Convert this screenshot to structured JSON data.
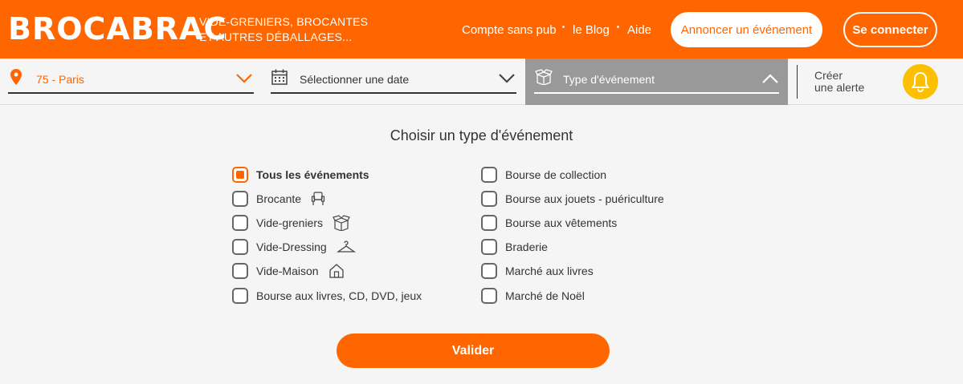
{
  "header": {
    "logo": "BROCABRAC",
    "tagline_line1": "VIDE-GRENIERS, BROCANTES",
    "tagline_line2": "ET AUTRES DÉBALLAGES...",
    "nav": {
      "no_ads": "Compte sans pub",
      "blog": "le Blog",
      "help": "Aide"
    },
    "announce_button": "Annoncer un événement",
    "login_button": "Se connecter"
  },
  "filters": {
    "location": "75 - Paris",
    "date": "Sélectionner une date",
    "type": "Type d'événement",
    "alert_line1": "Créer",
    "alert_line2": "une alerte"
  },
  "panel": {
    "title": "Choisir un type d'événement",
    "left_options": [
      {
        "label": "Tous les événements",
        "checked": true,
        "icon": ""
      },
      {
        "label": "Brocante",
        "checked": false,
        "icon": "armchair-icon"
      },
      {
        "label": "Vide-greniers",
        "checked": false,
        "icon": "open-box-icon"
      },
      {
        "label": "Vide-Dressing",
        "checked": false,
        "icon": "hanger-icon"
      },
      {
        "label": "Vide-Maison",
        "checked": false,
        "icon": "house-icon"
      },
      {
        "label": "Bourse aux livres, CD, DVD, jeux",
        "checked": false,
        "icon": ""
      }
    ],
    "right_options": [
      {
        "label": "Bourse de collection",
        "checked": false
      },
      {
        "label": "Bourse aux jouets - puériculture",
        "checked": false
      },
      {
        "label": "Bourse aux vêtements",
        "checked": false
      },
      {
        "label": "Braderie",
        "checked": false
      },
      {
        "label": "Marché aux livres",
        "checked": false
      },
      {
        "label": "Marché de Noël",
        "checked": false
      }
    ],
    "submit_button": "Valider"
  },
  "colors": {
    "brand_orange": "#ff6600",
    "alert_yellow": "#fcc000",
    "active_filter_gray": "#999999"
  }
}
